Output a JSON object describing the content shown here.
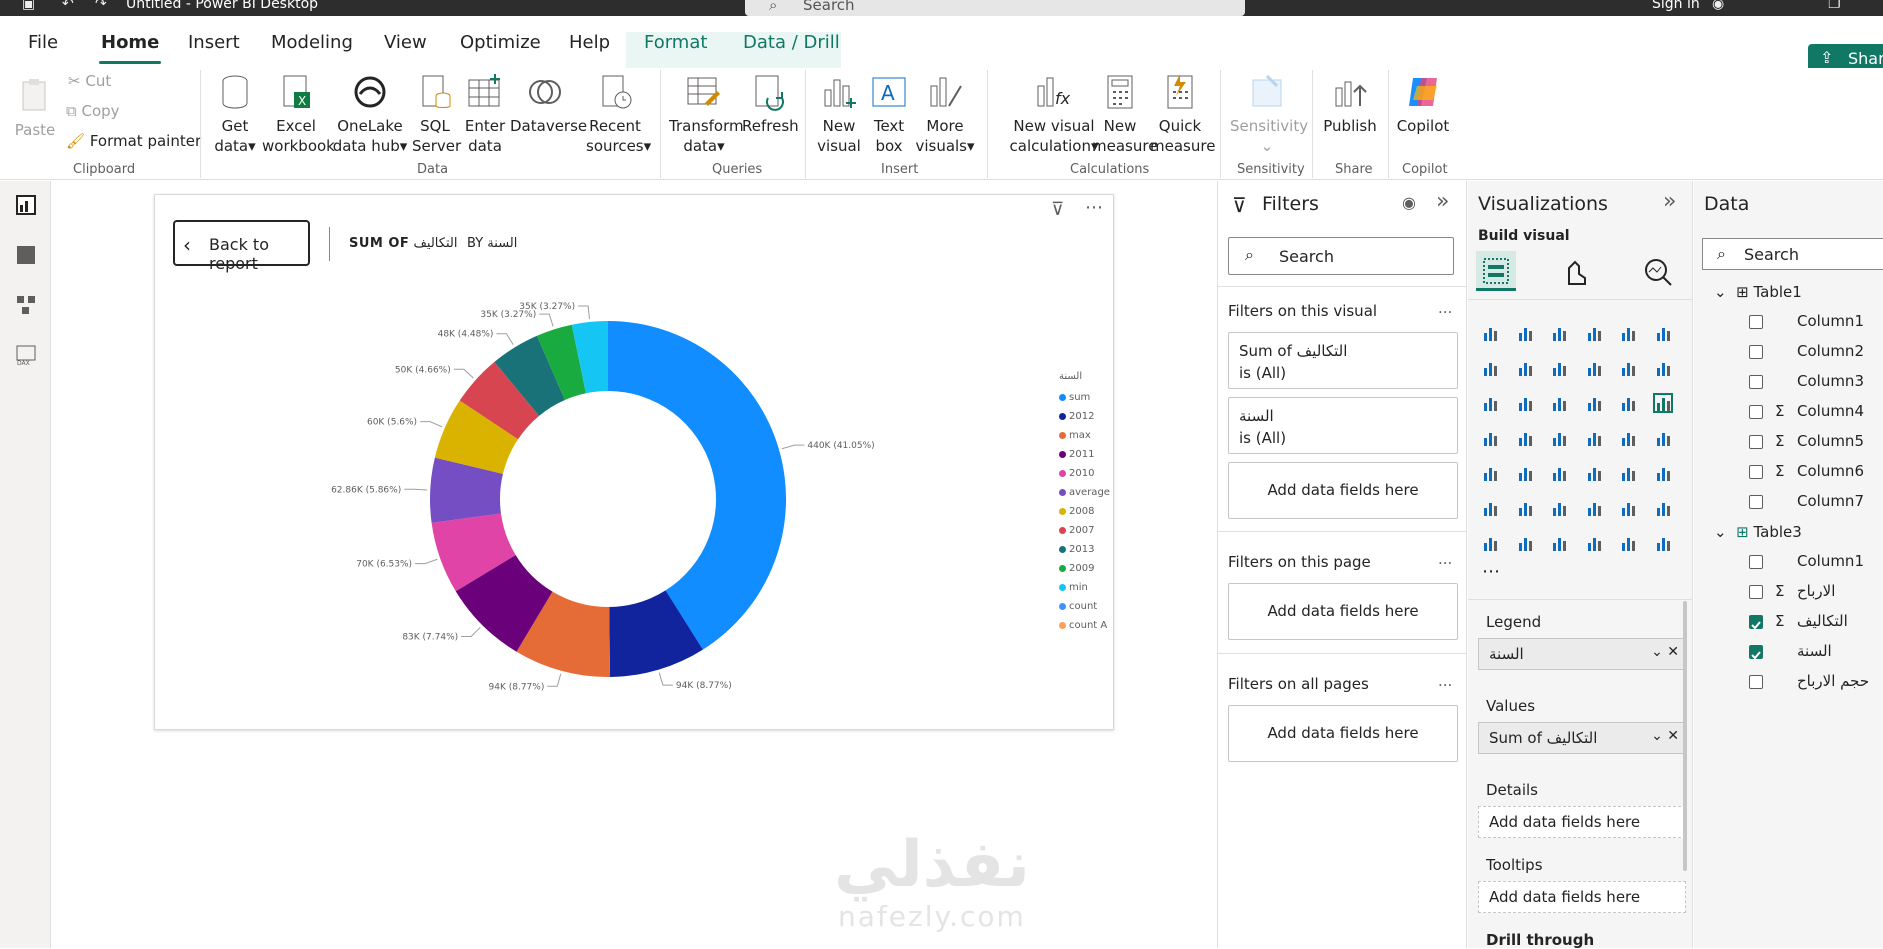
{
  "window": {
    "title": "Untitled - Power BI Desktop",
    "search": "Search",
    "signin": "Sign in"
  },
  "menu": {
    "items": [
      "File",
      "Home",
      "Insert",
      "Modeling",
      "View",
      "Optimize",
      "Help",
      "Format",
      "Data / Drill"
    ],
    "share": "Share"
  },
  "ribbon": {
    "clipboard": {
      "paste": "Paste",
      "cut": "Cut",
      "copy": "Copy",
      "format_painter": "Format painter",
      "label": "Clipboard"
    },
    "data": {
      "get_data": [
        "Get",
        "data"
      ],
      "excel": [
        "Excel",
        "workbook"
      ],
      "onelake": [
        "OneLake",
        "data hub"
      ],
      "sql": [
        "SQL",
        "Server"
      ],
      "enter": [
        "Enter",
        "data"
      ],
      "dataverse": "Dataverse",
      "recent": [
        "Recent",
        "sources"
      ],
      "label": "Data"
    },
    "queries": {
      "transform": [
        "Transform",
        "data"
      ],
      "refresh": "Refresh",
      "label": "Queries"
    },
    "insert": {
      "new_visual": [
        "New",
        "visual"
      ],
      "text_box": [
        "Text",
        "box"
      ],
      "more": [
        "More",
        "visuals"
      ],
      "label": "Insert"
    },
    "calculations": {
      "new_calc": [
        "New visual",
        "calculation"
      ],
      "new_measure": [
        "New",
        "measure"
      ],
      "quick": [
        "Quick",
        "measure"
      ],
      "label": "Calculations"
    },
    "sensitivity": {
      "btn": "Sensitivity",
      "label": "Sensitivity"
    },
    "share": {
      "publish": "Publish",
      "label": "Share"
    },
    "copilot": {
      "btn": "Copilot",
      "label": "Copilot"
    }
  },
  "report": {
    "back": "Back to report",
    "sum_of": "SUM OF",
    "measure": "التكاليف",
    "by": "BY",
    "dimension": "السنة"
  },
  "chart_data": {
    "type": "donut",
    "legend_title": "السنة",
    "legend_position": "right",
    "slices": [
      {
        "name": "sum",
        "value": 440,
        "label": "440K (41.05%)",
        "color": "#118DFF"
      },
      {
        "name": "2012",
        "value": 94,
        "label": "94K (8.77%)",
        "color": "#12239E"
      },
      {
        "name": "max",
        "value": 94,
        "label": "94K (8.77%)",
        "color": "#E66C37"
      },
      {
        "name": "2011",
        "value": 83,
        "label": "83K (7.74%)",
        "color": "#6B007B"
      },
      {
        "name": "2010",
        "value": 70,
        "label": "70K (6.53%)",
        "color": "#E044A7"
      },
      {
        "name": "average",
        "value": 62.86,
        "label": "62.86K (5.86%)",
        "color": "#744EC2"
      },
      {
        "name": "2008",
        "value": 60,
        "label": "60K (5.6%)",
        "color": "#D9B300"
      },
      {
        "name": "2007",
        "value": 50,
        "label": "50K (4.66%)",
        "color": "#D64550"
      },
      {
        "name": "2013",
        "value": 48,
        "label": "48K (4.48%)",
        "color": "#197278"
      },
      {
        "name": "2009",
        "value": 35,
        "label": "35K (3.27%)",
        "color": "#1AAB40"
      },
      {
        "name": "min",
        "value": 35,
        "label": "35K (3.27%)",
        "color": "#15C6F4"
      },
      {
        "name": "count",
        "value": 0,
        "label": "",
        "color": "#4092FF"
      },
      {
        "name": "count A",
        "value": 0,
        "label": "",
        "color": "#FFA058"
      }
    ]
  },
  "filters": {
    "title": "Filters",
    "search": "Search",
    "on_visual": "Filters on this visual",
    "cards": [
      {
        "name": "Sum of التكاليف",
        "state": "is (All)"
      },
      {
        "name": "السنة",
        "state": "is (All)"
      }
    ],
    "add": "Add data fields here",
    "on_page": "Filters on this page",
    "on_all": "Filters on all pages",
    "dots": "..."
  },
  "visualizations": {
    "title": "Visualizations",
    "build": "Build visual",
    "wells": {
      "legend": "Legend",
      "legend_value": "السنة",
      "values": "Values",
      "values_value": "Sum of التكاليف",
      "details": "Details",
      "tooltips": "Tooltips",
      "drill": "Drill through",
      "add": "Add data fields here"
    }
  },
  "data_pane": {
    "title": "Data",
    "search": "Search",
    "table1": "Table1",
    "table1_fields": [
      {
        "name": "Column1",
        "sigma": false,
        "checked": false
      },
      {
        "name": "Column2",
        "sigma": false,
        "checked": false
      },
      {
        "name": "Column3",
        "sigma": false,
        "checked": false
      },
      {
        "name": "Column4",
        "sigma": true,
        "checked": false
      },
      {
        "name": "Column5",
        "sigma": true,
        "checked": false
      },
      {
        "name": "Column6",
        "sigma": true,
        "checked": false
      },
      {
        "name": "Column7",
        "sigma": false,
        "checked": false
      }
    ],
    "table3": "Table3",
    "table3_fields": [
      {
        "name": "Column1",
        "sigma": false,
        "checked": false
      },
      {
        "name": "الارباح",
        "sigma": true,
        "checked": false
      },
      {
        "name": "التكاليف",
        "sigma": true,
        "checked": true
      },
      {
        "name": "السنة",
        "sigma": false,
        "checked": true
      },
      {
        "name": "حجم الارباح",
        "sigma": false,
        "checked": false
      }
    ]
  },
  "watermark": {
    "ar": "نفذلي",
    "en": "nafezly.com"
  },
  "colors": {
    "accent": "#117865"
  }
}
